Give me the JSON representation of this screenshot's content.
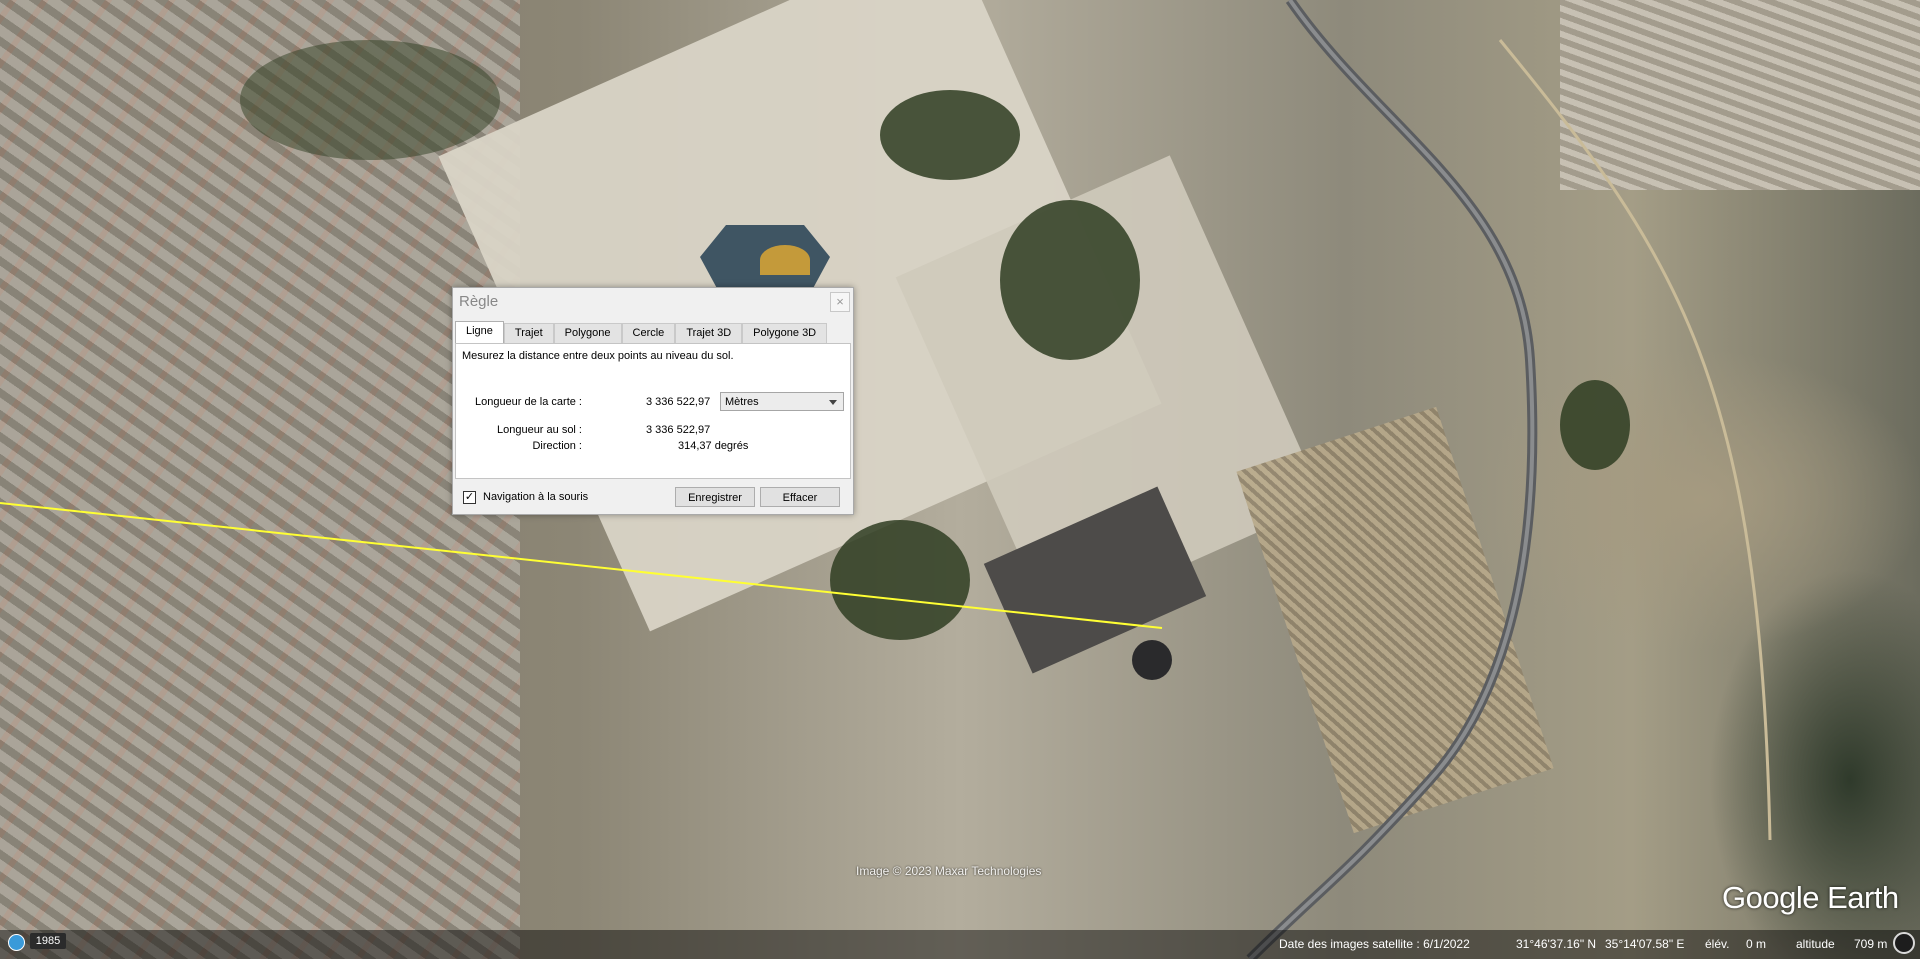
{
  "dialog": {
    "title": "Règle",
    "close_icon": "close-icon",
    "tabs": [
      "Ligne",
      "Trajet",
      "Polygone",
      "Cercle",
      "Trajet 3D",
      "Polygone 3D"
    ],
    "active_tab": "Ligne",
    "description": "Mesurez la distance entre deux points au niveau du sol.",
    "map_length_label": "Longueur de la carte :",
    "map_length_value": "3 336 522,97",
    "unit_selected": "Mètres",
    "ground_length_label": "Longueur au sol :",
    "ground_length_value": "3 336 522,97",
    "direction_label": "Direction :",
    "direction_value": "314,37 degrés",
    "mouse_nav_label": "Navigation à la souris",
    "mouse_nav_checked": true,
    "save_button": "Enregistrer",
    "clear_button": "Effacer"
  },
  "map": {
    "credit": "Image © 2023 Maxar Technologies",
    "logo": "Google Earth",
    "measure_line_color": "#ffff33"
  },
  "status_bar": {
    "year": "1985",
    "date_label": "Date des images satellite : 6/1/2022",
    "lat": "31°46'37.16\" N",
    "lon": "35°14'07.58\" E",
    "elev_label": "élév.",
    "elev_value": "0 m",
    "altitude_label": "altitude",
    "altitude_value": "709 m"
  }
}
